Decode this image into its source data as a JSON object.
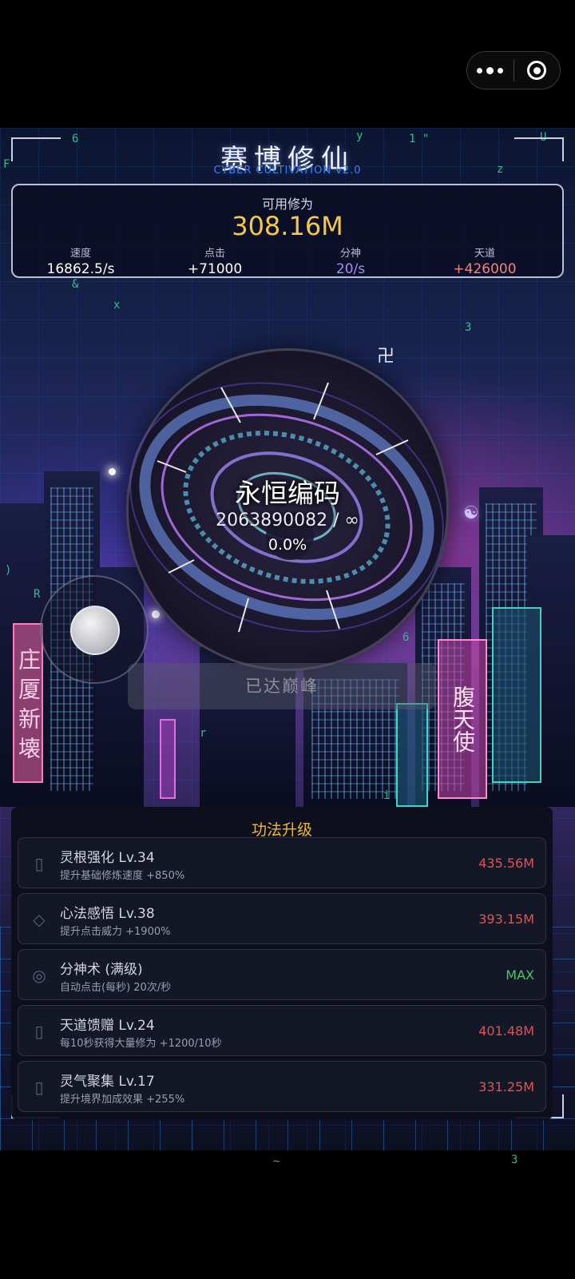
{
  "header": {
    "title": "赛博修仙",
    "subtitle": "CYBER CULTIVATION v2.0"
  },
  "stats": {
    "available_label": "可用修为",
    "available_value": "308.16M",
    "items": [
      {
        "label": "速度",
        "value": "16862.5/s",
        "color": "#ffffff"
      },
      {
        "label": "点击",
        "value": "+71000",
        "color": "#ffffff"
      },
      {
        "label": "分神",
        "value": "20/s",
        "color": "#a98bf5"
      },
      {
        "label": "天道",
        "value": "+426000",
        "color": "#f08484"
      }
    ]
  },
  "realm": {
    "name": "永恒编码",
    "progress_text": "2063890082 / ∞",
    "percent_text": "0.0%"
  },
  "peak_button": {
    "label": "已达巅峰"
  },
  "neon_signs": {
    "left": "庄 厦 新 壊",
    "right": "腹天使"
  },
  "floating_glyphs": [
    "卍",
    "☯"
  ],
  "upgrades": {
    "title": "功法升级",
    "items": [
      {
        "icon": "root-icon",
        "glyph": "▯",
        "name": "灵根强化 Lv.34",
        "desc": "提升基础修炼速度 +850%",
        "cost": "435.56M",
        "max": false
      },
      {
        "icon": "diamond-icon",
        "glyph": "◇",
        "name": "心法感悟 Lv.38",
        "desc": "提升点击威力 +1900%",
        "cost": "393.15M",
        "max": false
      },
      {
        "icon": "target-circle-icon",
        "glyph": "◎",
        "name": "分神术 (满级)",
        "desc": "自动点击(每秒) 20次/秒",
        "cost": "MAX",
        "max": true
      },
      {
        "icon": "gift-icon",
        "glyph": "▯",
        "name": "天道馈赠 Lv.24",
        "desc": "每10秒获得大量修为 +1200/10秒",
        "cost": "401.48M",
        "max": false
      },
      {
        "icon": "aura-icon",
        "glyph": "▯",
        "name": "灵气聚集 Lv.17",
        "desc": "提升境界加成效果 +255%",
        "cost": "331.25M",
        "max": false
      }
    ]
  },
  "colors": {
    "gold": "#f5c84a",
    "cost_red": "#e05252",
    "max_green": "#4cc46a",
    "accent_blue": "#3b82f6"
  }
}
